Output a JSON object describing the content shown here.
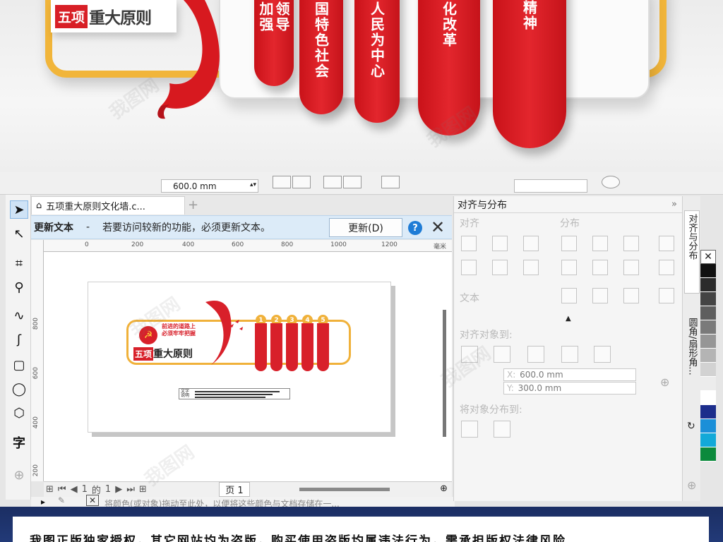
{
  "preview": {
    "title_red": "五项",
    "title_dark": "重大原则",
    "pillars": [
      {
        "lines": [
          "加强",
          "领导"
        ]
      },
      {
        "lines": [
          "国特色社会"
        ]
      },
      {
        "lines": [
          "人民为中心"
        ]
      },
      {
        "lines": [
          "化改革"
        ]
      },
      {
        "lines": [
          "精神"
        ]
      }
    ]
  },
  "propbar": {
    "size_value": "600.0 mm"
  },
  "document": {
    "tab_title": "五项重大原则文化墙.c..."
  },
  "update_bar": {
    "title": "更新文本",
    "dash": "-",
    "message": "若要访问较新的功能，必须更新文本。",
    "button_label": "更新(D)",
    "help": "?"
  },
  "ruler": {
    "h_ticks": [
      "0",
      "200",
      "400",
      "600",
      "800",
      "1000",
      "1200"
    ],
    "h_unit": "毫米",
    "v_ticks": [
      "800",
      "600",
      "400",
      "200"
    ]
  },
  "artwork": {
    "slogan_1": "前进的道路上",
    "slogan_2": "必须牢牢把握",
    "title_red": "五项",
    "title_dark": "重大原则",
    "numbers": [
      "1",
      "2",
      "3",
      "4",
      "5"
    ],
    "textbox_label_1": "文字",
    "textbox_label_2": "说明"
  },
  "pagenav": {
    "current": "1",
    "of": "的",
    "total": "1",
    "page_tab": "页 1"
  },
  "color_hint": "将颜色(或对象)拖动至此处，以便将这些颜色与文档存储在一...",
  "docker": {
    "title": "对齐与分布",
    "section_align": "对齐",
    "section_distribute": "分布",
    "section_text": "文本",
    "section_align_to": "对齐对象到:",
    "x_label": "X:",
    "x_value": "600.0 mm",
    "y_label": "Y:",
    "y_value": "300.0 mm",
    "section_distribute_to": "将对象分布到:"
  },
  "docker_tabs": {
    "tab1": "对齐与分布",
    "tab2": "圆角/扇形角..."
  },
  "palette": [
    "#ffffff",
    "#111111",
    "#2b2b2b",
    "#444444",
    "#5e5e5e",
    "#7a7a7a",
    "#969696",
    "#b4b4b4",
    "#d2d2d2",
    "#ececec",
    "#ffffff",
    "#1c2d8c",
    "#1b8fd8",
    "#12a9d8",
    "#0c8a3c"
  ],
  "footer": {
    "text": "我图正版独家授权，其它网站均为盗版，购买使用盗版均属违法行为，需承担版权法律风险"
  },
  "watermark": "我图网"
}
